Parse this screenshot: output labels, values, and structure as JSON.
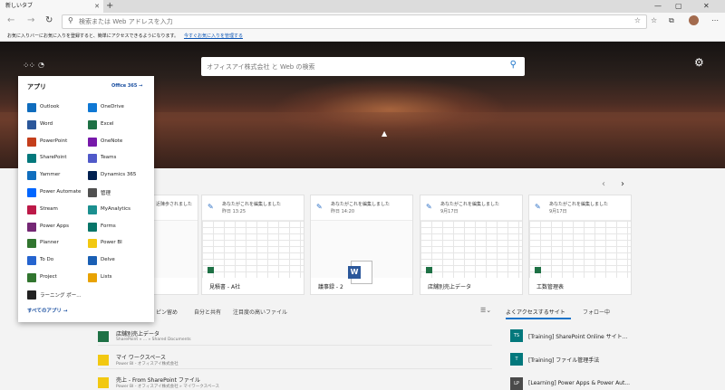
{
  "browser": {
    "tab_title": "新しいタブ",
    "tab_close": "✕",
    "new_tab": "+",
    "address_placeholder": "検索または Web アドレスを入力",
    "favorites_bar_text": "お気に入りバーにお気に入りを登録すると、簡単にアクセスできるようになります。",
    "favorites_bar_link": "今すぐお気に入りを管理する"
  },
  "hero": {
    "search_placeholder": "オフィスアイ株式会社 と Web の検索"
  },
  "app_launcher": {
    "title": "アプリ",
    "office365_link": "Office 365 →",
    "apps": [
      {
        "label": "Outlook",
        "icon": "outlook-icon",
        "color": "#0f6cbd"
      },
      {
        "label": "OneDrive",
        "icon": "onedrive-icon",
        "color": "#0f78d4"
      },
      {
        "label": "Word",
        "icon": "word-icon",
        "color": "#2b579a"
      },
      {
        "label": "Excel",
        "icon": "excel-icon",
        "color": "#1e7145"
      },
      {
        "label": "PowerPoint",
        "icon": "powerpoint-icon",
        "color": "#c43e1c"
      },
      {
        "label": "OneNote",
        "icon": "onenote-icon",
        "color": "#7719aa"
      },
      {
        "label": "SharePoint",
        "icon": "sharepoint-icon",
        "color": "#03787c"
      },
      {
        "label": "Teams",
        "icon": "teams-icon",
        "color": "#5059c9"
      },
      {
        "label": "Yammer",
        "icon": "yammer-icon",
        "color": "#106ebe"
      },
      {
        "label": "Dynamics 365",
        "icon": "dynamics-icon",
        "color": "#002050"
      },
      {
        "label": "Power Automate",
        "icon": "power-automate-icon",
        "color": "#0066ff"
      },
      {
        "label": "管理",
        "icon": "admin-icon",
        "color": "#505050"
      },
      {
        "label": "Stream",
        "icon": "stream-icon",
        "color": "#bc1948"
      },
      {
        "label": "MyAnalytics",
        "icon": "myanalytics-icon",
        "color": "#1b8f8f"
      },
      {
        "label": "Power Apps",
        "icon": "power-apps-icon",
        "color": "#742774"
      },
      {
        "label": "Forms",
        "icon": "forms-icon",
        "color": "#077568"
      },
      {
        "label": "Planner",
        "icon": "planner-icon",
        "color": "#31752f"
      },
      {
        "label": "Power BI",
        "icon": "power-bi-icon",
        "color": "#f2c811"
      },
      {
        "label": "To Do",
        "icon": "todo-icon",
        "color": "#2564cf"
      },
      {
        "label": "Delve",
        "icon": "delve-icon",
        "color": "#1a5fb4"
      },
      {
        "label": "Project",
        "icon": "project-icon",
        "color": "#31752f"
      },
      {
        "label": "Lists",
        "icon": "lists-icon",
        "color": "#e8a202"
      },
      {
        "label": "ラーニング ポー...",
        "icon": "learning-icon",
        "color": "#222222"
      }
    ],
    "all_apps": "すべてのアプリ →"
  },
  "recent_cards": [
    {
      "activity": "近陳歩されました",
      "time": "",
      "title": ""
    },
    {
      "activity": "あなたがこれを編集しました",
      "time": "昨日 13:25",
      "title": "見積書 - A社"
    },
    {
      "activity": "あなたがこれを編集しました",
      "time": "昨日 14:20",
      "title": "議事録 - 2"
    },
    {
      "activity": "あなたがこれを編集しました",
      "time": "9月17日",
      "title": "店舗別売上データ"
    },
    {
      "activity": "あなたがこれを編集しました",
      "time": "9月17日",
      "title": "工数管理表"
    }
  ],
  "file_tabs": [
    "ピン留め",
    "自分と共有",
    "注目度の高いファイル"
  ],
  "files": [
    {
      "name": "店舗別売上データ",
      "path": "SharePoint » ... » Shared Documents"
    },
    {
      "name": "マイ ワークスペース",
      "path": "Power BI - オフィスアイ株式会社"
    },
    {
      "name": "売上 - From SharePoint ファイル",
      "path": "Power BI - オフィスアイ株式会社 » マイワークスペース"
    }
  ],
  "site_tabs": {
    "active": "よくアクセスするサイト",
    "other": "フォロー中"
  },
  "sites": [
    {
      "abbr": "TS",
      "name": "[Training] SharePoint Online サイト...",
      "color": "#03787c"
    },
    {
      "abbr": "T",
      "name": "[Training] ファイル管理手法",
      "color": "#03787c"
    },
    {
      "abbr": "LP",
      "name": "[Learning] Power Apps & Power Aut...",
      "color": "#4a4a4a"
    }
  ]
}
